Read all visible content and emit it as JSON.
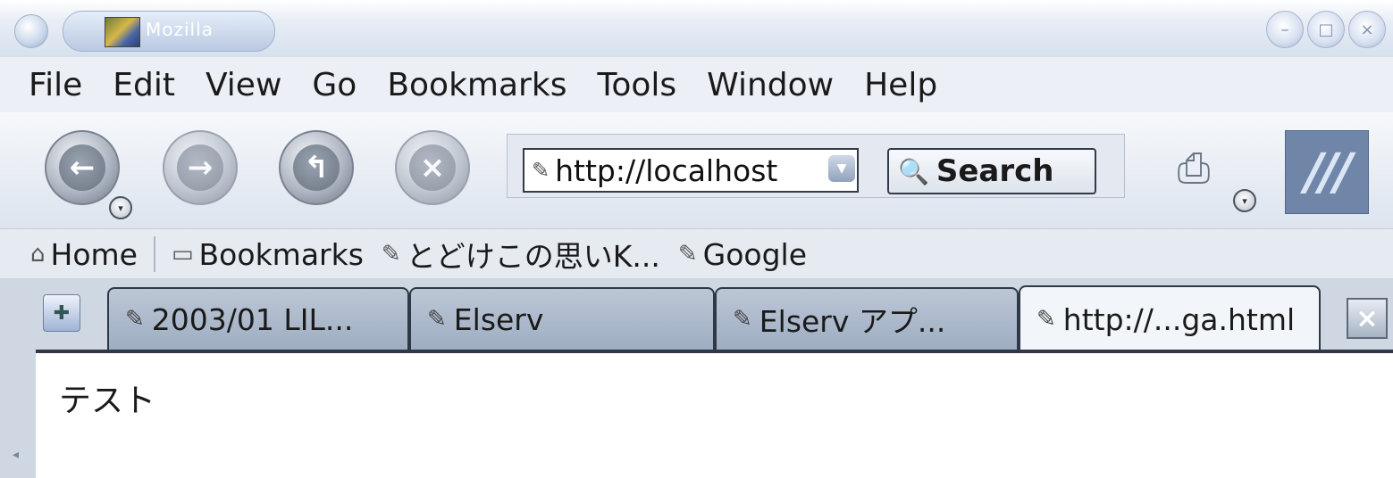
{
  "window": {
    "title": "Mozilla"
  },
  "menubar": {
    "items": [
      "File",
      "Edit",
      "View",
      "Go",
      "Bookmarks",
      "Tools",
      "Window",
      "Help"
    ]
  },
  "navbar": {
    "url": "http://localhost",
    "search_label": "Search"
  },
  "personal_toolbar": {
    "items": [
      {
        "label": "Home",
        "icon": "home-icon"
      },
      {
        "label": "Bookmarks",
        "icon": "folder-icon"
      },
      {
        "label": "とどけこの思いK...",
        "icon": "bookmark-icon"
      },
      {
        "label": "Google",
        "icon": "bookmark-icon"
      }
    ]
  },
  "tabs": [
    {
      "label": "2003/01 LIL..."
    },
    {
      "label": "Elserv"
    },
    {
      "label": "Elserv アプ..."
    },
    {
      "label": "http://...ga.html",
      "active": true
    }
  ],
  "content": {
    "text": "テスト"
  },
  "colors": {
    "chrome": "#dde4ee",
    "tab_border": "#2f3846",
    "throbber": "#6f86a8"
  }
}
